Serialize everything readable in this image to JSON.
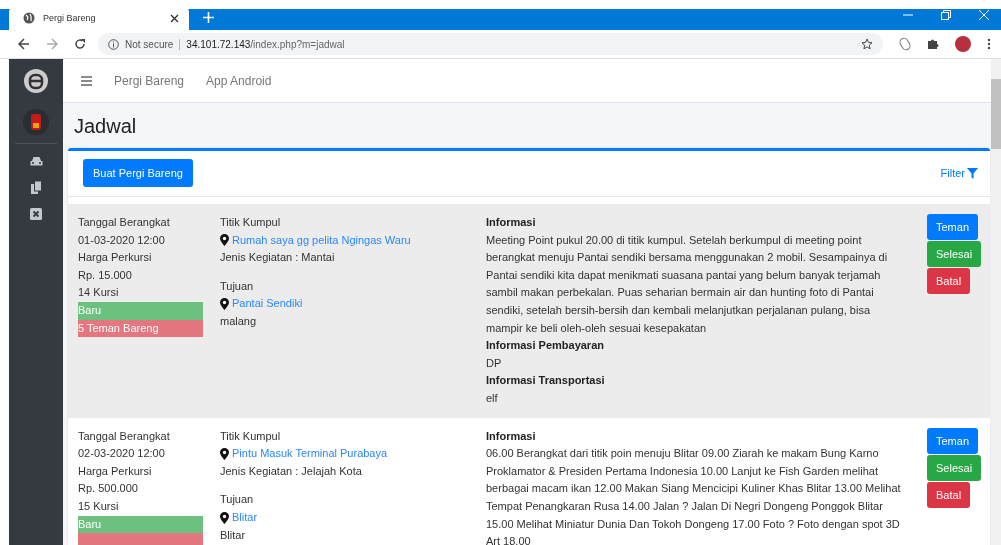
{
  "browser": {
    "tab_title": "Pergi Bareng",
    "security": "Not secure",
    "url_host": "34.101.72.143",
    "url_path": "/index.php?m=jadwal"
  },
  "navbar": {
    "links": [
      "Pergi Bareng",
      "App Android"
    ]
  },
  "page_title": "Jadwal",
  "create_button": "Buat Pergi Bareng",
  "filter_link": "Filter",
  "records": [
    {
      "shaded": true,
      "date_label": "Tanggal Berangkat",
      "date": "01-03-2020 12:00",
      "price_label": "Harga Perkursi",
      "price": "Rp. 15.000",
      "seats": "14 Kursi",
      "badges": [
        {
          "text": "Baru",
          "color": "#6dc17f"
        },
        {
          "text": "5 Teman Bareng",
          "color": "#e3767e"
        }
      ],
      "meet_label": "Titik Kumpul",
      "meet_place": "Rumah saya gg pelita Ngingas Waru",
      "activity": "Jenis Kegiatan : Mantai",
      "dest_label": "Tujuan",
      "dest_place": "Pantai Sendiki",
      "dest_city": "malang",
      "sections": [
        {
          "heading": "Informasi",
          "text": "Meeting Point pukul 20.00 di titik kumpul. Setelah berkumpul di meeting point berangkat menuju Pantai sendiki bersama menggunakan 2 mobil. Sesampainya di Pantai sendiki kita dapat menikmati suasana pantai yang belum banyak terjamah sambil makan perbekalan. Puas seharian bermain air dan hunting foto di Pantai sendiki, setelah bersih-bersih dan kembali melanjutkan perjalanan pulang, bisa mampir ke beli oleh-oleh sesuai kesepakatan"
        },
        {
          "heading": "Informasi Pembayaran",
          "text": "DP"
        },
        {
          "heading": "Informasi Transportasi",
          "text": "elf"
        }
      ],
      "buttons": [
        {
          "label": "Teman",
          "kind": "primary"
        },
        {
          "label": "Selesai",
          "kind": "success"
        },
        {
          "label": "Batal",
          "kind": "danger"
        }
      ]
    },
    {
      "shaded": false,
      "date_label": "Tanggal Berangkat",
      "date": "02-03-2020 12:00",
      "price_label": "Harga Perkursi",
      "price": "Rp. 500.000",
      "seats": "15 Kursi",
      "badges": [
        {
          "text": "Baru",
          "color": "#6dc17f"
        },
        {
          "color": "#e3767e"
        }
      ],
      "meet_label": "Titik Kumpul",
      "meet_place": "Pintu Masuk Terminal Purabaya",
      "activity": "Jenis Kegiatan : Jelajah Kota",
      "dest_label": "Tujuan",
      "dest_place": "Blitar",
      "dest_city": "Blitar",
      "sections": [
        {
          "heading": "Informasi",
          "text": "06.00 Berangkat dari titik poin menuju Blitar 09.00 Ziarah ke makam Bung Karno Proklamator & Presiden Pertama Indonesia 10.00 Lanjut ke Fish Garden melihat berbagai macam ikan 12.00 Makan Siang Mencicipi Kuliner Khas Blitar 13.00 Melihat Tempat Penangkaran Rusa 14.00 Jalan ? Jalan Di Negri Dongeng Ponggok Blitar 15.00 Melihat Miniatur Dunia Dan Tokoh Dongeng 17.00 Foto ? Foto dengan spot 3D Art 18.00"
        }
      ],
      "buttons": [
        {
          "label": "Teman",
          "kind": "primary"
        },
        {
          "label": "Selesai",
          "kind": "success"
        },
        {
          "label": "Batal",
          "kind": "danger"
        }
      ]
    }
  ]
}
